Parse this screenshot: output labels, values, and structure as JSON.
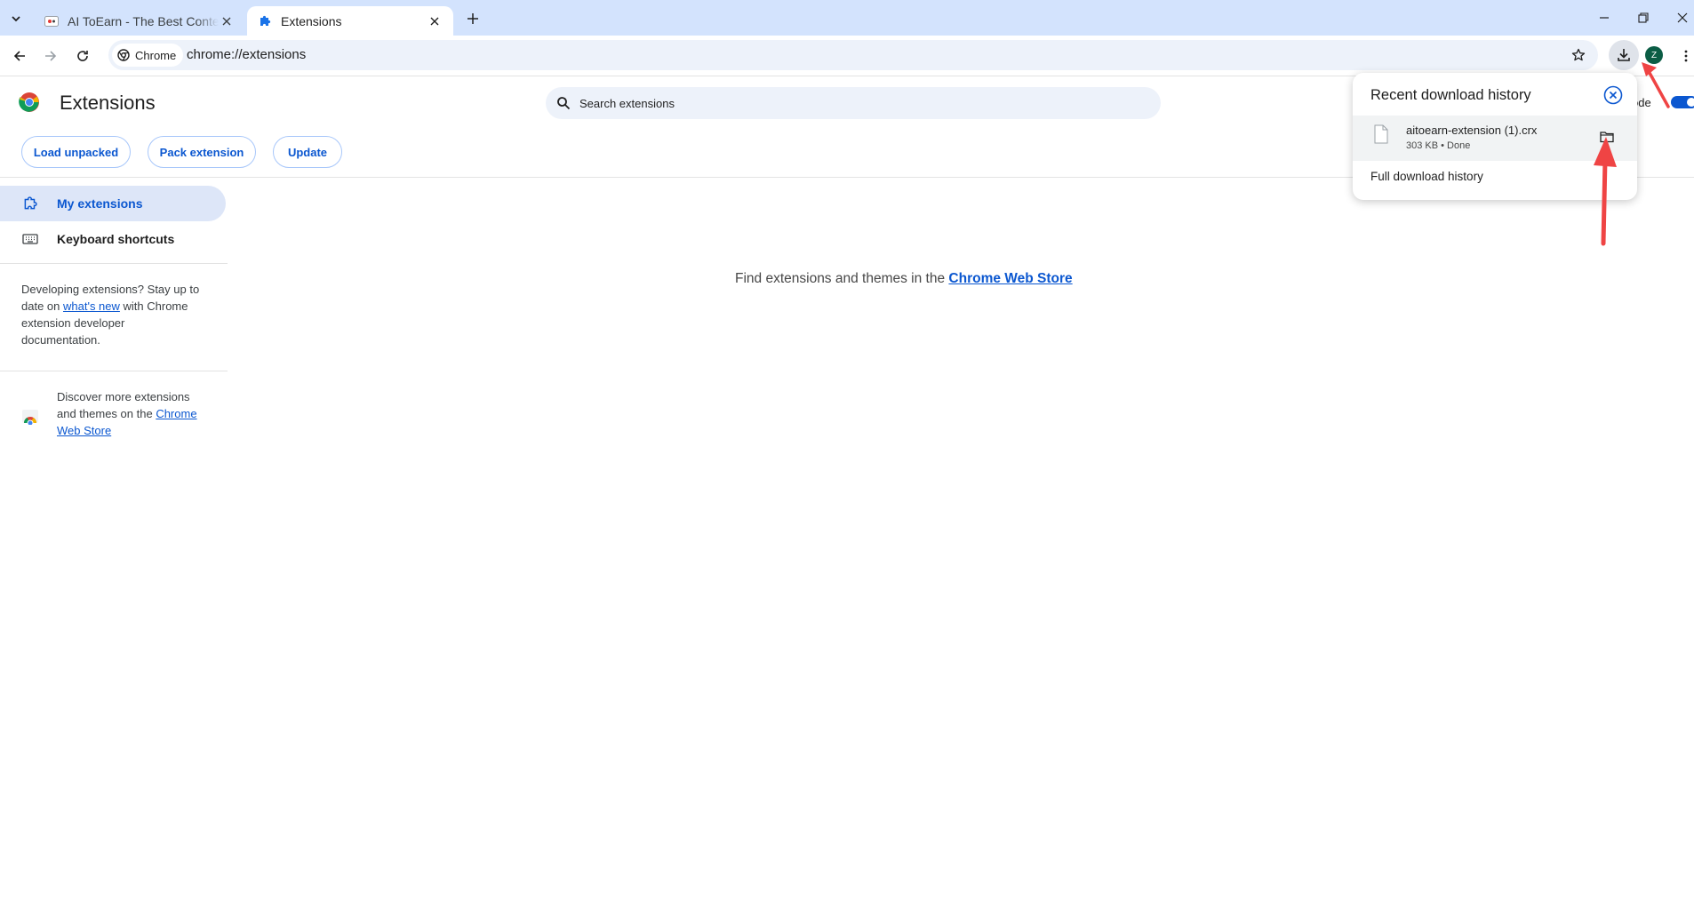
{
  "tabs": [
    {
      "title": "AI ToEarn - The Best Content"
    },
    {
      "title": "Extensions"
    }
  ],
  "toolbar": {
    "site_chip": "Chrome",
    "url": "chrome://extensions",
    "avatar_initial": "Z"
  },
  "page": {
    "title": "Extensions",
    "search_placeholder": "Search extensions",
    "dev_mode_label": "ode",
    "buttons": {
      "load_unpacked": "Load unpacked",
      "pack_extension": "Pack extension",
      "update": "Update"
    }
  },
  "sidebar": {
    "items": [
      {
        "label": "My extensions"
      },
      {
        "label": "Keyboard shortcuts"
      }
    ],
    "dev_text_before": "Developing extensions? Stay up to date on ",
    "dev_link": "what's new",
    "dev_text_after": " with Chrome extension developer documentation.",
    "discover_text": "Discover more extensions and themes on the ",
    "discover_link": "Chrome Web Store"
  },
  "main": {
    "message": "Find extensions and themes in the ",
    "message_link": "Chrome Web Store"
  },
  "download_bubble": {
    "title": "Recent download history",
    "item": {
      "filename": "aitoearn-extension (1).crx",
      "status": "303 KB • Done"
    },
    "full_history": "Full download history"
  },
  "colors": {
    "accent": "#0b57d0",
    "tabstrip": "#d3e3fd",
    "annotation_arrow": "#ef4444"
  },
  "icons": [
    "tab-list-icon",
    "favicon-icon",
    "puzzle-icon",
    "close-icon",
    "plus-icon",
    "minimize-icon",
    "restore-icon",
    "back-icon",
    "forward-icon",
    "reload-icon",
    "chrome-icon",
    "star-icon",
    "download-icon",
    "more-vert-icon",
    "search-icon",
    "keyboard-icon",
    "web-store-icon",
    "file-icon",
    "folder-icon"
  ]
}
